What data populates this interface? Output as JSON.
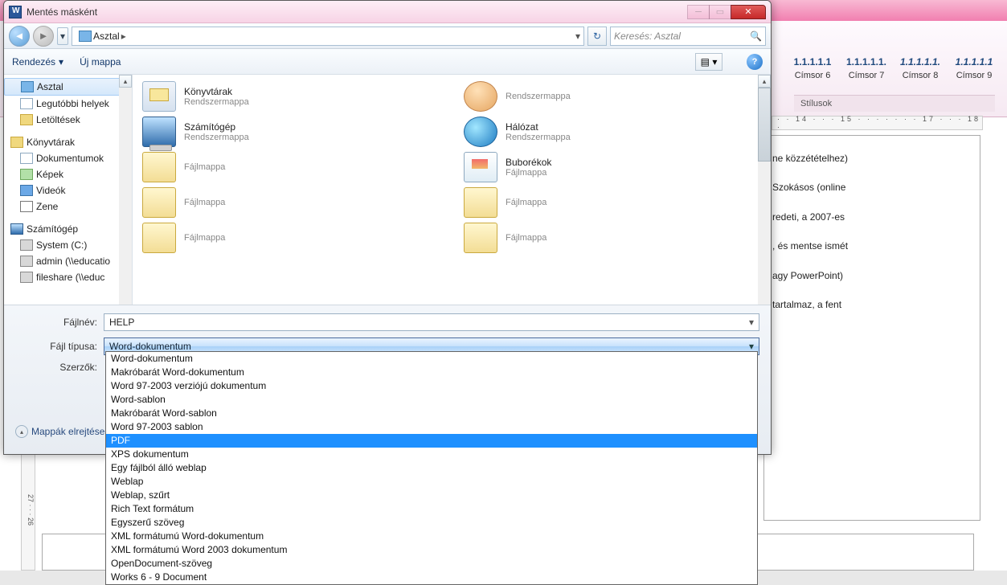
{
  "word_bg": {
    "styles": [
      {
        "num": "1.1.1.1.1",
        "caption": "Címsor 6",
        "italic": false
      },
      {
        "num": "1.1.1.1.1.",
        "caption": "Címsor 7",
        "italic": false
      },
      {
        "num": "1.1.1.1.1.",
        "caption": "Címsor 8",
        "italic": true
      },
      {
        "num": "1.1.1.1.1",
        "caption": "Címsor 9",
        "italic": true
      }
    ],
    "stilusok": "Stílusok",
    "ruler": "· · 14 · · · 15 · · · · · · · 17 · · · 18 ·",
    "left_ruler": "27 · · · 26",
    "paragraphs": [
      "ne közzétételhez)",
      "Szokásos  (online",
      "redeti, a 2007-es",
      ", és mentse ismét",
      "agy  PowerPoint)",
      "tartalmaz, a fent"
    ]
  },
  "dialog": {
    "title": "Mentés másként",
    "nav": {
      "address_segment": "Asztal",
      "search_placeholder": "Keresés: Asztal"
    },
    "toolbar": {
      "organize": "Rendezés",
      "newfolder": "Új mappa"
    },
    "sidebar": {
      "favorites": [
        {
          "label": "Asztal"
        },
        {
          "label": "Legutóbbi helyek"
        },
        {
          "label": "Letöltések"
        }
      ],
      "libraries_hdr": "Könyvtárak",
      "libraries": [
        {
          "label": "Dokumentumok"
        },
        {
          "label": "Képek"
        },
        {
          "label": "Videók"
        },
        {
          "label": "Zene"
        }
      ],
      "computer_hdr": "Számítógép",
      "computer": [
        {
          "label": "System (C:)"
        },
        {
          "label": "admin (\\\\educatio"
        },
        {
          "label": "fileshare (\\\\educ"
        }
      ]
    },
    "files": [
      {
        "name": "Könyvtárak",
        "sub": "Rendszermappa",
        "kind": "library"
      },
      {
        "name": "",
        "sub": "Rendszermappa",
        "kind": "user"
      },
      {
        "name": "Számítógép",
        "sub": "Rendszermappa",
        "kind": "computer"
      },
      {
        "name": "Hálózat",
        "sub": "Rendszermappa",
        "kind": "network"
      },
      {
        "name": "",
        "sub": "Fájlmappa",
        "kind": "fldempty"
      },
      {
        "name": "Buborékok",
        "sub": "Fájlmappa",
        "kind": "picture"
      },
      {
        "name": "",
        "sub": "Fájlmappa",
        "kind": "fldempty"
      },
      {
        "name": "",
        "sub": "Fájlmappa",
        "kind": "fldempty"
      },
      {
        "name": "",
        "sub": "Fájlmappa",
        "kind": "fldempty"
      },
      {
        "name": "",
        "sub": "Fájlmappa",
        "kind": "fldempty"
      }
    ],
    "bottom": {
      "filename_lbl": "Fájlnév:",
      "filename_val": "HELP",
      "filetype_lbl": "Fájl típusa:",
      "filetype_val": "Word-dokumentum",
      "authors_lbl": "Szerzők:",
      "hide_folders": "Mappák elrejtése"
    }
  },
  "dropdown_options": [
    "Word-dokumentum",
    "Makróbarát Word-dokumentum",
    "Word 97-2003 verziójú dokumentum",
    "Word-sablon",
    "Makróbarát Word-sablon",
    "Word 97-2003 sablon",
    "PDF",
    "XPS dokumentum",
    "Egy fájlból álló weblap",
    "Weblap",
    "Weblap, szűrt",
    "Rich Text formátum",
    "Egyszerű szöveg",
    "XML formátumú Word-dokumentum",
    "XML formátumú Word 2003 dokumentum",
    "OpenDocument-szöveg",
    "Works 6 - 9 Document"
  ],
  "dropdown_selected_index": 6
}
